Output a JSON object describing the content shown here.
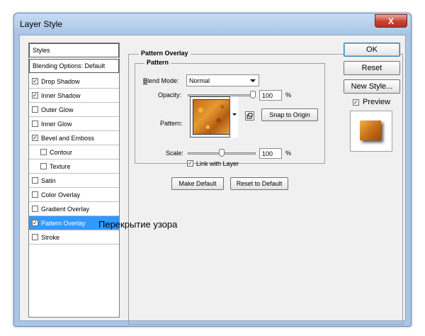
{
  "window": {
    "title": "Layer Style",
    "close_glyph": "X"
  },
  "styles_panel": {
    "header": "Styles",
    "blending": "Blending Options: Default",
    "items": [
      {
        "label": "Drop Shadow",
        "checked": true
      },
      {
        "label": "Inner Shadow",
        "checked": true
      },
      {
        "label": "Outer Glow",
        "checked": false
      },
      {
        "label": "Inner Glow",
        "checked": false
      },
      {
        "label": "Bevel and Emboss",
        "checked": true
      },
      {
        "label": "Contour",
        "checked": false,
        "indent": true
      },
      {
        "label": "Texture",
        "checked": false,
        "indent": true
      },
      {
        "label": "Satin",
        "checked": false
      },
      {
        "label": "Color Overlay",
        "checked": false
      },
      {
        "label": "Gradient Overlay",
        "checked": false
      },
      {
        "label": "Pattern Overlay",
        "checked": true,
        "selected": true
      },
      {
        "label": "Stroke",
        "checked": false
      }
    ]
  },
  "pattern_overlay": {
    "group_title": "Pattern Overlay",
    "sub_title": "Pattern",
    "blend_mode_label": "Blend Mode:",
    "blend_mode_value": "Normal",
    "opacity_label": "Opacity:",
    "opacity_value": "100",
    "opacity_unit": "%",
    "opacity_level": 1.0,
    "pattern_label": "Pattern:",
    "snap_button": "Snap to Origin",
    "scale_label": "Scale:",
    "scale_value": "100",
    "scale_unit": "%",
    "scale_level": 0.5,
    "link_label": "Link with Layer",
    "link_checked": true,
    "make_default": "Make Default",
    "reset_default": "Reset to Default"
  },
  "right_panel": {
    "ok": "OK",
    "reset": "Reset",
    "new_style": "New Style...",
    "preview_label": "Preview",
    "preview_checked": true
  },
  "caption": "Перекрытие узора",
  "colors": {
    "selection": "#3399ff",
    "title_bar": "#a9c6e6",
    "dialog_bg": "#f0f0f0",
    "close_button": "#c7412e"
  }
}
